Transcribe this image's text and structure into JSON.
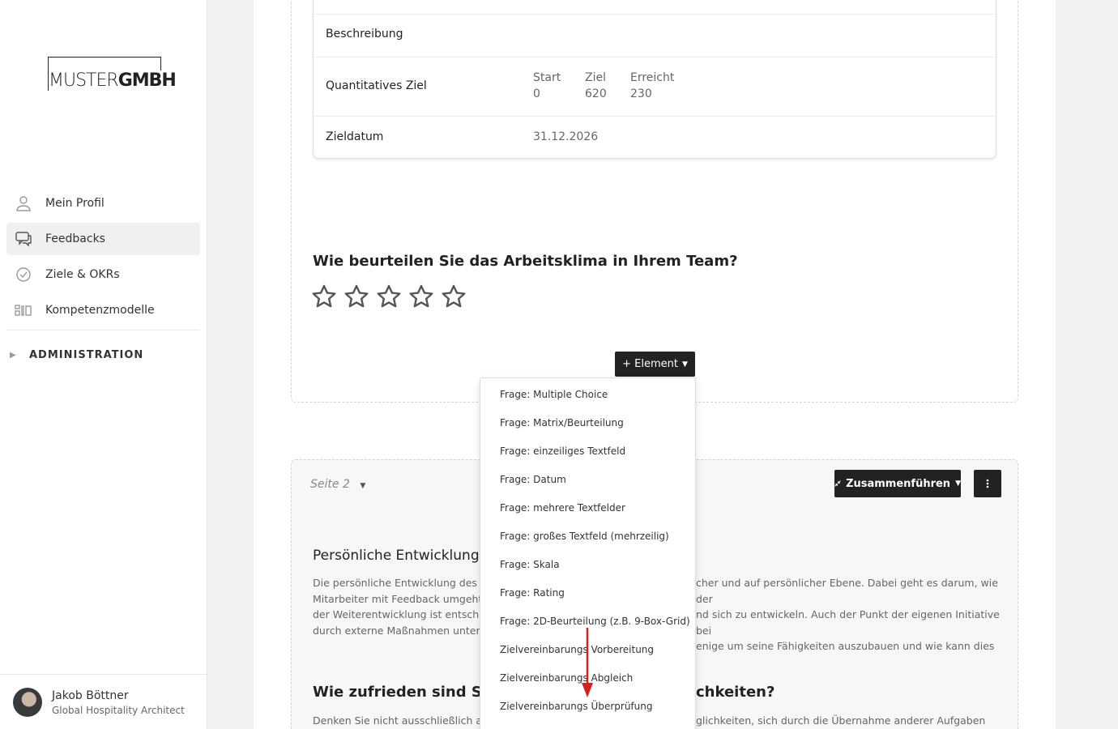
{
  "sidebar": {
    "logo": {
      "part1": "MUSTER",
      "part2": "GMBH"
    },
    "items": [
      {
        "label": "Mein Profil",
        "icon": "user-icon",
        "active": false
      },
      {
        "label": "Feedbacks",
        "icon": "chat-icon",
        "active": true
      },
      {
        "label": "Ziele & OKRs",
        "icon": "check-circle-icon",
        "active": false
      },
      {
        "label": "Kompetenzmodelle",
        "icon": "grid-icon",
        "active": false
      }
    ],
    "admin_label": "ADMINISTRATION",
    "user": {
      "name": "Jakob Böttner",
      "role": "Global Hospitality Architect"
    }
  },
  "goal_card": {
    "rows": [
      {
        "label": "Beschreibung"
      },
      {
        "label": "Quantitatives Ziel"
      },
      {
        "label": "Zieldatum",
        "value": "31.12.2026"
      }
    ],
    "quant": {
      "start_label": "Start",
      "start_value": "0",
      "target_label": "Ziel",
      "target_value": "620",
      "reached_label": "Erreicht",
      "reached_value": "230"
    }
  },
  "rating_question": {
    "title": "Wie beurteilen Sie das Arbeitsklima in Ihrem Team?",
    "stars": 5,
    "value": 0
  },
  "element_button": "+ Element",
  "page2": {
    "label": "Seite 2",
    "merge_label": "Zusammenführen",
    "section1_title": "Persönliche Entwicklung",
    "section1_text": [
      "Die persönliche Entwicklung des Mi",
      "Mitarbeiter mit Feedback umgeht u",
      "der Weiterentwicklung ist entschei",
      "durch externe Maßnahmen unters"
    ],
    "section1_text_right": [
      "cher und auf persönlicher Ebene. Dabei geht es darum, wie der",
      "nd sich zu entwickeln. Auch der Punkt der eigenen Initiative bei",
      "enige um seine Fähigkeiten auszubauen und wie kann dies"
    ],
    "section2_title_left": "Wie zufrieden sind Sie",
    "section2_title_right": "chkeiten?",
    "section2_text_left": "Denken Sie nicht ausschließlich an Tr",
    "section2_text_right": "glichkeiten, sich durch die Übernahme anderer Aufgaben und"
  },
  "dropdown": {
    "items": [
      "Frage: Multiple Choice",
      "Frage: Matrix/Beurteilung",
      "Frage: einzeiliges Textfeld",
      "Frage: Datum",
      "Frage: mehrere Textfelder",
      "Frage: großes Textfeld (mehrzeilig)",
      "Frage: Skala",
      "Frage: Rating",
      "Frage: 2D-Beurteilung (z.B. 9-Box-Grid)",
      "Zielvereinbarungs Vorbereitung",
      "Zielvereinbarungs Abgleich",
      "Zielvereinbarungs Überprüfung"
    ]
  },
  "colors": {
    "accent_dark": "#222222",
    "annotation_arrow": "#d62020",
    "star_outline": "#555555"
  }
}
